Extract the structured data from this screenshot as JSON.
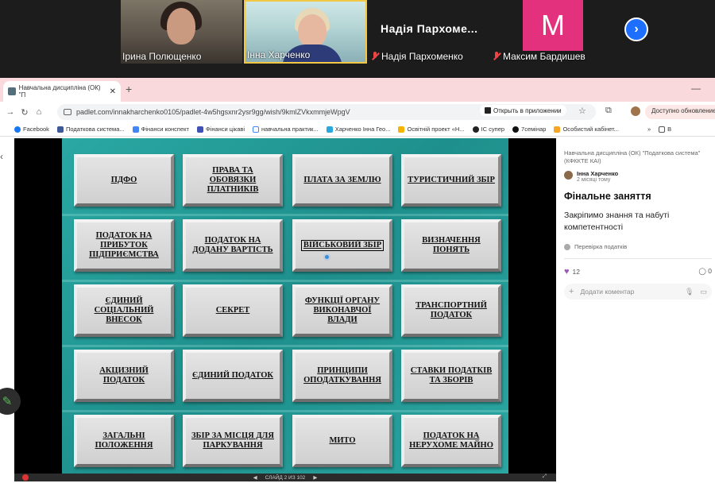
{
  "call": {
    "participants": [
      {
        "name": "Ірина Полющенко",
        "muted": false
      },
      {
        "name": "Інна Харченко",
        "muted": false
      },
      {
        "name": "Надія Пархоменко",
        "muted": true,
        "big_name": "Надія Пархоме..."
      },
      {
        "name": "Максим Бардишев",
        "muted": true,
        "avatar_letter": "M"
      }
    ],
    "next_icon": "chevron-right-icon"
  },
  "browser": {
    "tab_title": "Навчальна дисципліна (ОК) \"П",
    "tab_close": "✕",
    "new_tab": "+",
    "minimize": "—",
    "url": "padlet.com/innakharchenko0105/padlet-4w5hgsxnr2ysr9gg/wish/9kmlZVkxmmjeWpgV",
    "open_in_app": "Открыть в приложении",
    "update_label": "Доступно обновление",
    "bookmarks": [
      "Facebook",
      "Податкова система...",
      "Фінанси конспект",
      "Фінанси цікаві",
      "навчальна практик...",
      "Харченко Інна Гео...",
      "Освітній проект «Н...",
      "IC супер",
      "7семінар",
      "Особистий кабінет..."
    ],
    "bookmarks_more": "»",
    "bookmarks_folder": "B"
  },
  "slide": {
    "cards": [
      "ПДФО",
      "ПРАВА ТА ОБОВЯЗКИ ПЛАТНИКІВ",
      "ПЛАТА ЗА ЗЕМЛЮ",
      "ТУРИСТИЧНИЙ ЗБІР",
      "ПОДАТОК НА ПРИБУТОК ПІДПРИЄМСТВА",
      "ПОДАТОК НА ДОДАНУ ВАРТІСТЬ",
      "ВІЙСЬКОВИЙ ЗБІР",
      "ВИЗНАЧЕННЯ ПОНЯТЬ",
      "ЄДИНИЙ СОЦІАЛЬНИЙ ВНЕСОК",
      "СЕКРЕТ",
      "ФУНКЦІЇ ОРГАНУ ВИКОНАВЧОЇ ВЛАДИ",
      "ТРАНСПОРТНИЙ ПОДАТОК",
      "АКЦИЗНИЙ ПОДАТОК",
      "ЄДИНИЙ ПОДАТОК",
      "ПРИНЦИПИ ОПОДАТКУВАННЯ",
      "СТАВКИ ПОДАТКІВ ТА ЗБОРІВ",
      "ЗАГАЛЬНІ ПОЛОЖЕННЯ",
      "ЗБІР ЗА МІСЦЯ ДЛЯ ПАРКУВАННЯ",
      "МИТО",
      "ПОДАТОК НА НЕРУХОМЕ МАЙНО"
    ],
    "counter": "СЛАЙД 2 ИЗ 102",
    "prev": "◀",
    "next": "▶"
  },
  "post": {
    "breadcrumb": "Навчальна дисципліна (ОК) \"Податкова система\" (КФККТЕ КАІ)",
    "author": "Інна Харченко",
    "time": "2 місяці тому",
    "title": "Фінальне заняття",
    "body": "Закріпимо знання та набуті компетентності",
    "tag": "Перевірка податків",
    "likes": "12",
    "comments": "0",
    "comment_placeholder": "Додати коментар"
  }
}
